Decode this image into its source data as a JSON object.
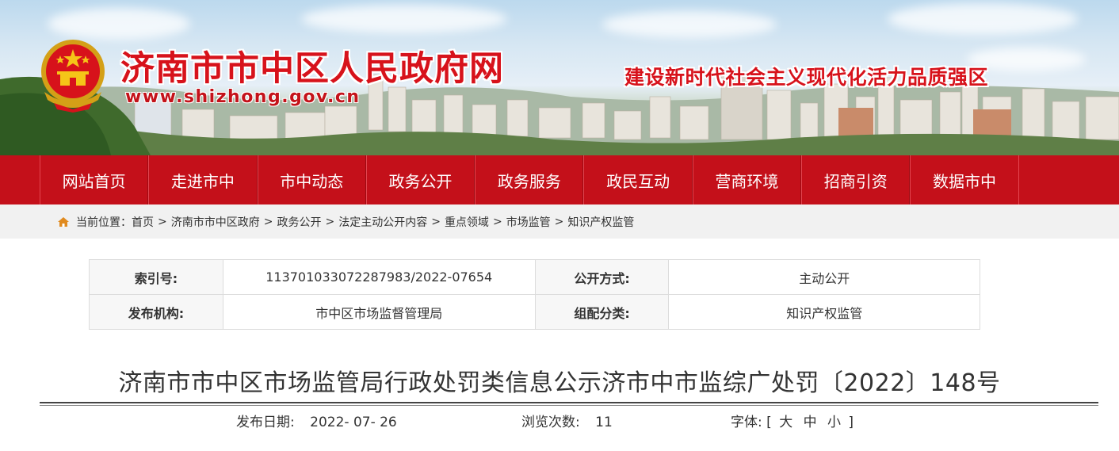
{
  "header": {
    "site_title": "济南市市中区人民政府网",
    "site_url": "www.shizhong.gov.cn",
    "slogan": "建设新时代社会主义现代化活力品质强区",
    "colors": {
      "brand_red": "#c4101a",
      "title_red": "#d7121b"
    }
  },
  "nav": {
    "items": [
      {
        "label": "网站首页"
      },
      {
        "label": "走进市中"
      },
      {
        "label": "市中动态"
      },
      {
        "label": "政务公开"
      },
      {
        "label": "政务服务"
      },
      {
        "label": "政民互动"
      },
      {
        "label": "营商环境"
      },
      {
        "label": "招商引资"
      },
      {
        "label": "数据市中"
      }
    ]
  },
  "breadcrumb": {
    "prefix": "当前位置：",
    "icon": "home-icon",
    "separator": ">",
    "items": [
      "首页",
      "济南市市中区政府",
      "政务公开",
      "法定主动公开内容",
      "重点领域",
      "市场监管",
      "知识产权监管"
    ]
  },
  "info": {
    "index_label": "索引号:",
    "index_value": "11370103307228​7983/2022-07654",
    "open_method_label": "公开方式:",
    "open_method_value": "主动公开",
    "publisher_label": "发布机构:",
    "publisher_value": "市中区市场监督管理局",
    "category_label": "组配分类:",
    "category_value": "知识产权监管"
  },
  "article": {
    "title": "济南市市中区市场监管局行政处罚类信息公示济市中市监综广处罚〔2022〕148号",
    "date_label": "发布日期:",
    "date_value": "2022- 07- 26",
    "views_label": "浏览次数:",
    "views_value": "11",
    "font_label": "字体:",
    "font_open": "[",
    "font_large": "大",
    "font_medium": "中",
    "font_small": "小",
    "font_close": "]"
  }
}
